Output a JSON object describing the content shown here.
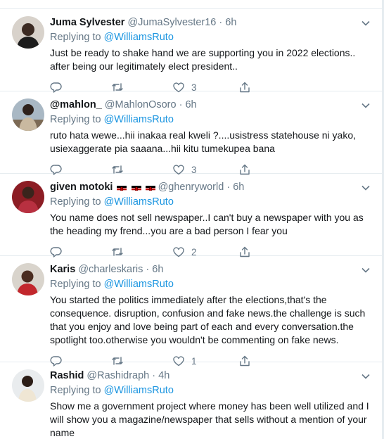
{
  "tweets": [
    {
      "name": "Juma Sylvester",
      "handle": "@JumaSylvester16",
      "time": "6h",
      "replying_label": "Replying to",
      "mention": "@WilliamsRuto",
      "text": "Just be ready to shake hand we are supporting you in 2022 elections.. after being our legitimately elect president..",
      "like_count": "3"
    },
    {
      "name": "@mahlon_",
      "handle": "@MahlonOsoro",
      "time": "6h",
      "replying_label": "Replying to",
      "mention": "@WilliamsRuto",
      "text": "ruto hata wewe...hii inakaa real kweli ?....usistress statehouse ni yako, usiexaggerate pia saaana...hii kitu tumekupea bana",
      "like_count": "3"
    },
    {
      "name": "given motoki",
      "handle": "@ghenryworld",
      "time": "6h",
      "replying_label": "Replying to",
      "mention": "@WilliamsRuto",
      "text": "You name does not sell newspaper..I can't buy a newspaper with you as the heading my frend...you are a bad person I fear you",
      "like_count": "2"
    },
    {
      "name": "Karis",
      "handle": "@charleskaris",
      "time": "6h",
      "replying_label": "Replying to",
      "mention": "@WilliamsRuto",
      "text": "You started the politics immediately after the elections,that's the consequence. disruption, confusion and fake news.the challenge is such that you enjoy and love being part of each and every conversation.the spotlight too.otherwise you wouldn't be commenting on fake news.",
      "like_count": "1"
    },
    {
      "name": "Rashid",
      "handle": "@Rashidraph",
      "time": "4h",
      "replying_label": "Replying to",
      "mention": "@WilliamsRuto",
      "text": "Show me a government project where money has been well utilized and I will show you a magazine/newspaper that sells without a mention of your name",
      "like_count": ""
    }
  ],
  "separator": "·",
  "colors": {
    "link": "#1b95e0",
    "muted": "#657786",
    "text": "#14171a",
    "border": "#e6ecf0"
  },
  "icons": [
    "reply-icon",
    "retweet-icon",
    "like-icon",
    "share-icon",
    "chevron-down-icon",
    "kenya-flag-icon"
  ]
}
